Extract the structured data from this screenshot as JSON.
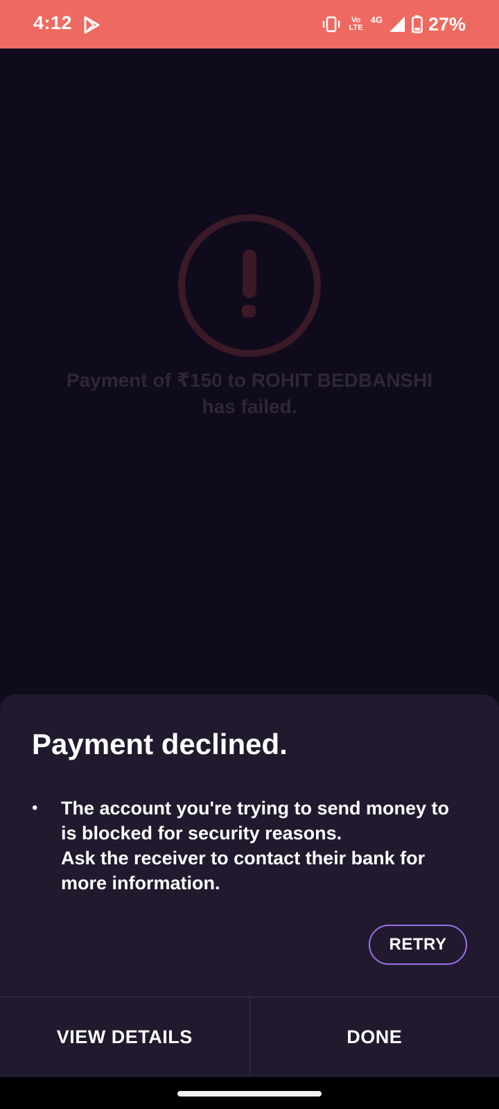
{
  "status_bar": {
    "time": "4:12",
    "network_top": "Vo",
    "network_bottom": "LTE",
    "network_type": "4G",
    "battery": "27%",
    "icons": [
      "play-store-icon",
      "vibrate-icon",
      "volte-icon",
      "signal-icon",
      "battery-icon"
    ]
  },
  "background": {
    "status_icon": "exclamation-circle-icon",
    "message_line1": "Payment of ₹150 to ROHIT BEDBANSHI",
    "message_line2": "has failed."
  },
  "sheet": {
    "title": "Payment declined.",
    "bullet_line1": "The account you're trying to send money to",
    "bullet_line2": "is blocked for security reasons.",
    "bullet_line3": "Ask the receiver to contact their bank for",
    "bullet_line4": "more information.",
    "retry_label": "RETRY",
    "view_details_label": "VIEW DETAILS",
    "done_label": "DONE"
  },
  "colors": {
    "status_bar": "#ee6a60",
    "background": "#0f0a1c",
    "sheet": "#211a2e",
    "retry_border": "#9d6ef0",
    "failure_icon": "#3a1a26"
  }
}
